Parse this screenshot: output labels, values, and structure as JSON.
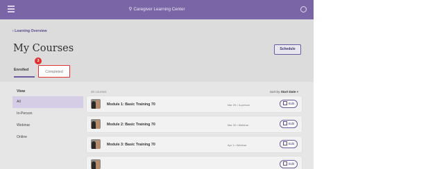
{
  "topbar": {
    "title": "Caregiver Learning Center",
    "location_icon": "location-pin-icon"
  },
  "breadcrumb": "Learning Overview",
  "page_title": "My Courses",
  "schedule_label": "Schedule",
  "tabs": {
    "enrolled": "Enrolled",
    "completed": "Completed"
  },
  "badge_number": "3",
  "sidebar": {
    "heading": "View",
    "items": [
      "All",
      "In-Person",
      "Webinar",
      "Online"
    ]
  },
  "list": {
    "count": "20 courses",
    "sort_prefix": "Sort by",
    "sort_value": "Start Date",
    "rows": [
      {
        "title": "Module 1: Basic Training 70",
        "meta": "Mar 29  •  In-person",
        "edit": "Edit"
      },
      {
        "title": "Module 2: Basic Training 70",
        "meta": "Mar 30  •  Webinar",
        "edit": "Edit"
      },
      {
        "title": "Module 3: Basic Training 70",
        "meta": "Apr 1  •  Webinar",
        "edit": "Edit"
      },
      {
        "title": "",
        "meta": "",
        "edit": "Edit"
      }
    ]
  },
  "colors": {
    "brand": "#7a65a6",
    "accent": "#6a58a0",
    "badge": "#e02d2d"
  }
}
